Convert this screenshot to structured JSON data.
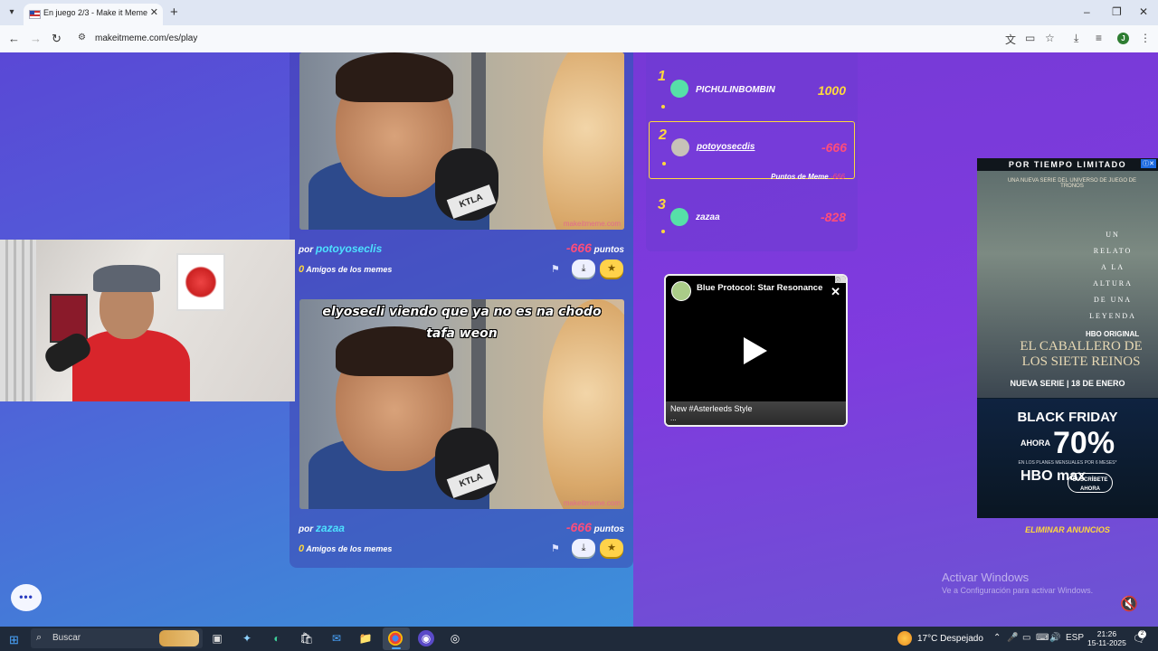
{
  "browser": {
    "tab_title": "En juego 2/3 - Make it Meme",
    "url": "makeitmeme.com/es/play",
    "profile_initial": "J",
    "window_controls": [
      "–",
      "❐",
      "✕"
    ]
  },
  "memes": [
    {
      "caption": "",
      "watermark": "makeitmeme.com",
      "por_label": "por",
      "author": "potoyoseclis",
      "score": "-666",
      "score_unit": "puntos",
      "friends_count": "0",
      "friends_label": "Amigos de los memes"
    },
    {
      "caption": "elyosecli viendo que ya no es na chodo tafa weon",
      "watermark": "makeitmeme.com",
      "por_label": "por",
      "author": "zazaa",
      "score": "-666",
      "score_unit": "puntos",
      "friends_count": "0",
      "friends_label": "Amigos de los memes"
    }
  ],
  "mic_flag_text": "KTLA",
  "leaderboard": [
    {
      "rank": "1",
      "name": "PICHULINBOMBIN",
      "score": "1000",
      "score_color": "#ffd83d",
      "avatar_color": "#56e0a8"
    },
    {
      "rank": "2",
      "name": "potoyosecdis",
      "score": "-666",
      "score_color": "#ff4d7a",
      "avatar_color": "#c7c2b8",
      "meme_points_label": "Puntos de Meme",
      "meme_points": "-666"
    },
    {
      "rank": "3",
      "name": "zazaa",
      "score": "-828",
      "score_color": "#ff4d7a",
      "avatar_color": "#56e0a8"
    }
  ],
  "video_ad": {
    "title": "Blue Protocol: Star Resonance",
    "caption": "New #Asterleeds Style",
    "dots": "..."
  },
  "side_ad": {
    "header": "POR TIEMPO LIMITADO",
    "subtitle": "UNA NUEVA SERIE DEL UNIVERSO DE JUEGO DE TRONOS",
    "poem": [
      "UN",
      "RELATO",
      "A LA",
      "ALTURA",
      "DE UNA",
      "LEYENDA"
    ],
    "hbo_original": "HBO ORIGINAL",
    "movie_title": "EL CABALLERO DE LOS SIETE REINOS",
    "date": "NUEVA SERIE | 18 DE ENERO",
    "black_friday": "BLACK FRIDAY",
    "now": "AHORA",
    "percent": "70%",
    "plans_note": "EN LOS PLANES MENSUALES POR 6 MESES*",
    "logo": "HBO max",
    "subscribe": "SUSCRÍBETE AHORA"
  },
  "remove_ads": "ELIMINAR ANUNCIOS",
  "activate_windows": {
    "title": "Activar Windows",
    "subtitle": "Ve a Configuración para activar Windows."
  },
  "chat_button": "•••",
  "taskbar": {
    "search_placeholder": "Buscar",
    "weather": "17°C  Despejado",
    "language": "ESP",
    "time": "21:26",
    "date": "15-11-2025",
    "notifications": "2"
  }
}
